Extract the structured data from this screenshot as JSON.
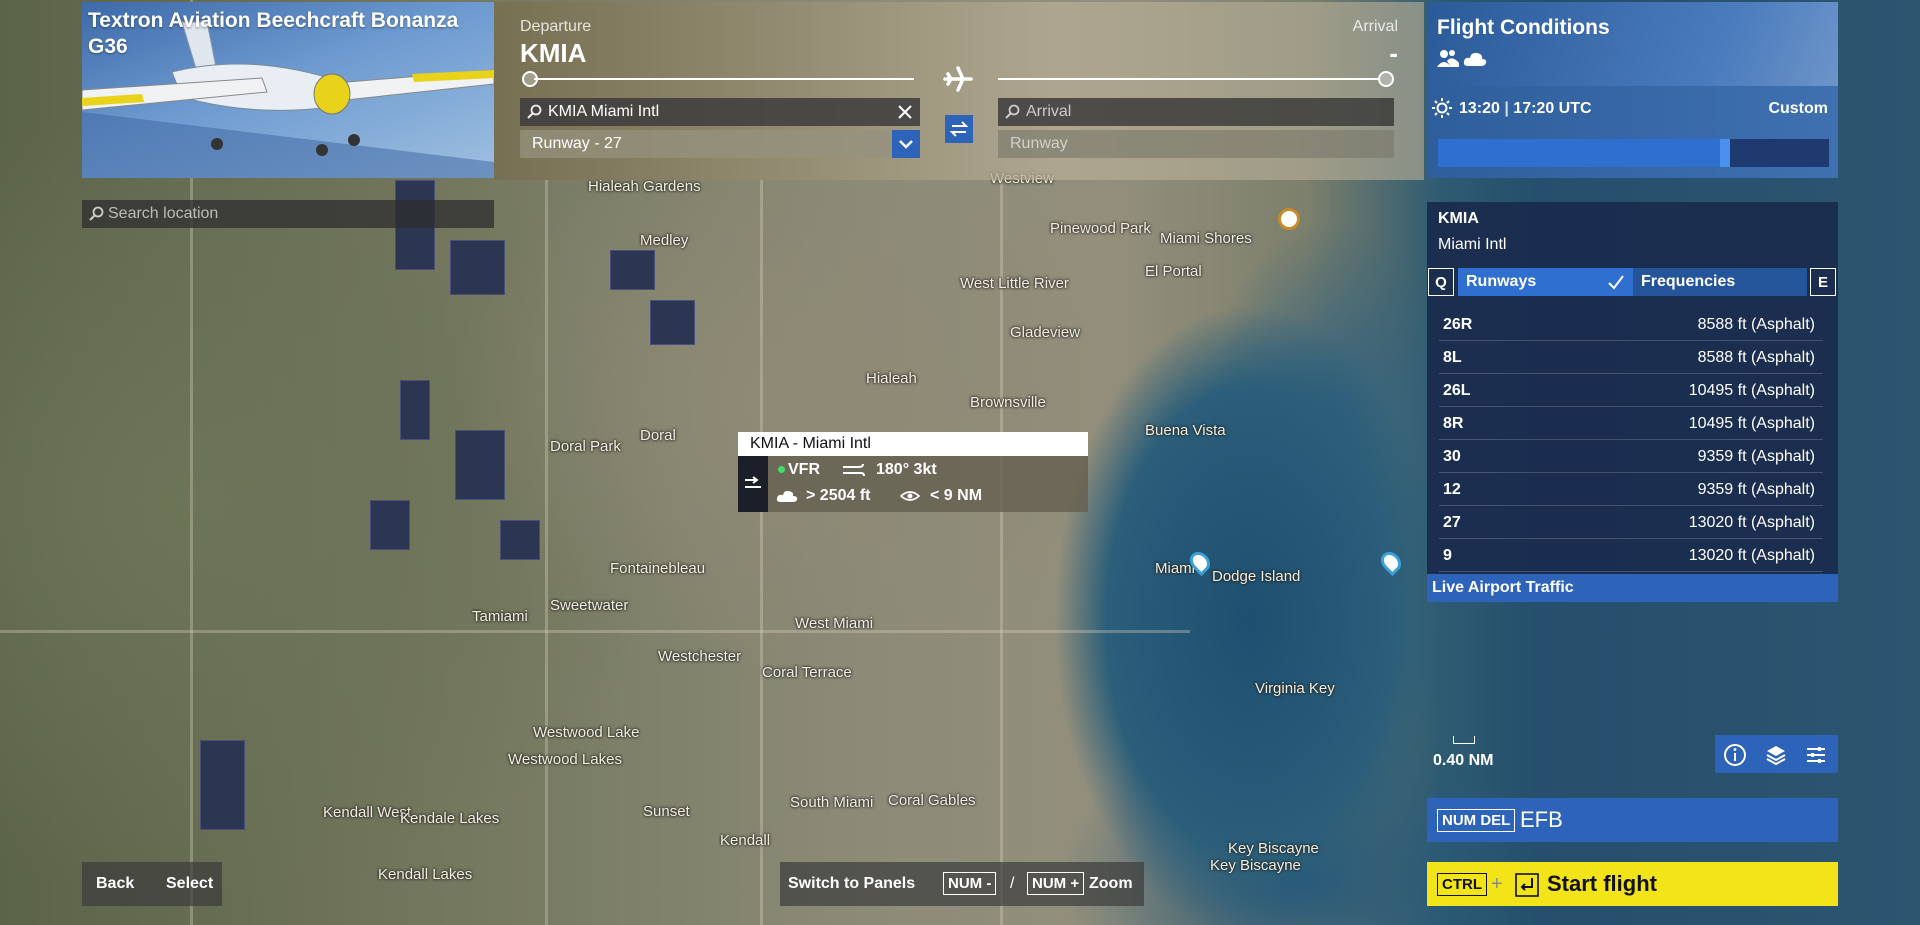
{
  "aircraft": {
    "title": "Textron Aviation Beechcraft Bonanza G36"
  },
  "search_location": {
    "placeholder": "Search location"
  },
  "route": {
    "departure_label": "Departure",
    "departure_code": "KMIA",
    "arrival_label": "Arrival",
    "arrival_code": "-",
    "departure_search_value": "KMIA Miami Intl",
    "arrival_search_placeholder": "Arrival",
    "departure_runway": "Runway - 27",
    "arrival_runway": "Runway"
  },
  "flight_conditions": {
    "title": "Flight Conditions",
    "time_local": "13:20",
    "time_utc": "17:20 UTC",
    "mode": "Custom",
    "time_slider_fraction": 0.72
  },
  "airport": {
    "code": "KMIA",
    "name": "Miami Intl",
    "key_left": "Q",
    "key_right": "E",
    "tab_runways": "Runways",
    "tab_frequencies": "Frequencies",
    "runways": [
      {
        "name": "26R",
        "detail": "8588 ft (Asphalt)"
      },
      {
        "name": "8L",
        "detail": "8588 ft (Asphalt)"
      },
      {
        "name": "26L",
        "detail": "10495 ft (Asphalt)"
      },
      {
        "name": "8R",
        "detail": "10495 ft (Asphalt)"
      },
      {
        "name": "30",
        "detail": "9359 ft (Asphalt)"
      },
      {
        "name": "12",
        "detail": "9359 ft (Asphalt)"
      },
      {
        "name": "27",
        "detail": "13020 ft (Asphalt)"
      },
      {
        "name": "9",
        "detail": "13020 ft (Asphalt)"
      }
    ],
    "live_traffic": "Live Airport Traffic"
  },
  "tooltip": {
    "title": "KMIA - Miami Intl",
    "rules": "VFR",
    "wind": "180° 3kt",
    "ceiling": "> 2504 ft",
    "visibility": "< 9 NM"
  },
  "scale": {
    "label": "0.40 NM"
  },
  "efb": {
    "key": "NUM DEL",
    "label": "EFB"
  },
  "start": {
    "key": "CTRL",
    "plus": "+",
    "label": "Start flight"
  },
  "bottom": {
    "back": "Back",
    "select": "Select",
    "switch_panels": "Switch to Panels",
    "zoom_out_key": "NUM -",
    "zoom_sep": "/",
    "zoom_in_key": "NUM +",
    "zoom_label": "Zoom"
  },
  "map_labels": [
    "Hialeah Gardens",
    "Medley",
    "Westview",
    "Pinewood Park",
    "Miami Shores",
    "El Portal",
    "West Little River",
    "Gladeview",
    "Hialeah",
    "Brownsville",
    "Buena Vista",
    "Doral",
    "Doral Park",
    "Fontainebleau",
    "Miami",
    "Dodge Island",
    "Tamiami",
    "Sweetwater",
    "West Miami",
    "Westchester",
    "Coral Terrace",
    "Virginia Key",
    "Westwood Lake",
    "Westwood Lakes",
    "Sunset",
    "South Miami",
    "Coral Gables",
    "Kendall West",
    "Kendale Lakes",
    "Kendall",
    "Kendall Lakes",
    "Key Biscayne",
    "Key Biscayne"
  ]
}
